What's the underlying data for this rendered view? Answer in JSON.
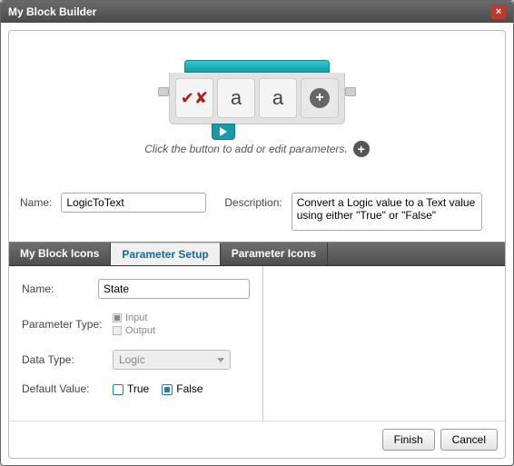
{
  "window": {
    "title": "My Block Builder"
  },
  "preview": {
    "hint": "Click the button to add or edit parameters.",
    "slots": {
      "a1": "a",
      "a2": "a"
    }
  },
  "fields": {
    "name_label": "Name:",
    "name_value": "LogicToText",
    "desc_label": "Description:",
    "desc_value": "Convert a Logic value to a Text value using either \"True\" or \"False\""
  },
  "tabs": {
    "icons": "My Block Icons",
    "param_setup": "Parameter Setup",
    "param_icons": "Parameter Icons"
  },
  "param": {
    "name_label": "Name:",
    "name_value": "State",
    "type_label": "Parameter Type:",
    "type_input": "Input",
    "type_output": "Output",
    "data_type_label": "Data Type:",
    "data_type_value": "Logic",
    "default_label": "Default Value:",
    "true_label": "True",
    "false_label": "False"
  },
  "buttons": {
    "finish": "Finish",
    "cancel": "Cancel"
  }
}
